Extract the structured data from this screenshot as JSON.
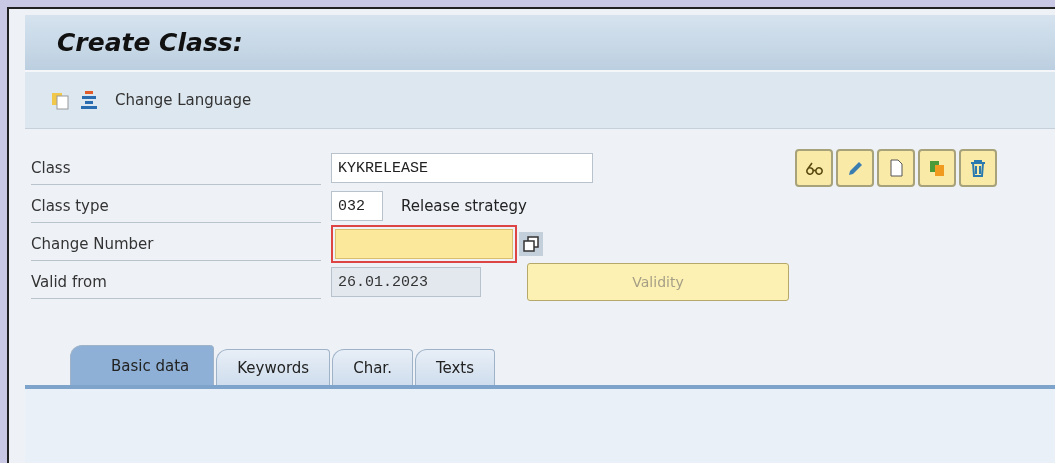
{
  "window": {
    "title": "Create Class:"
  },
  "toolbar": {
    "buttons": [
      {
        "kind": "clipboard"
      },
      {
        "kind": "hierarchy"
      },
      {
        "kind": "text",
        "label": "Change Language"
      }
    ]
  },
  "fields": [
    {
      "label": "Class",
      "value": "KYKRELEASE",
      "kind": "text"
    },
    {
      "label": "Class type",
      "value": "032",
      "kind": "text",
      "description": "Release strategy"
    },
    {
      "label": "Change Number",
      "kind": "required",
      "has_popup": true
    },
    {
      "label": "Valid from",
      "value": "26.01.2023",
      "kind": "readonly",
      "button": {
        "label": "Validity",
        "disabled": true
      }
    }
  ],
  "actions": [
    {
      "kind": "display"
    },
    {
      "kind": "edit"
    },
    {
      "kind": "new"
    },
    {
      "kind": "copy"
    },
    {
      "kind": "delete"
    }
  ],
  "tabs": [
    {
      "label": "Basic data",
      "selected": true
    },
    {
      "label": "Keywords",
      "selected": false
    },
    {
      "label": "Char.",
      "selected": false
    },
    {
      "label": "Texts",
      "selected": false
    }
  ]
}
